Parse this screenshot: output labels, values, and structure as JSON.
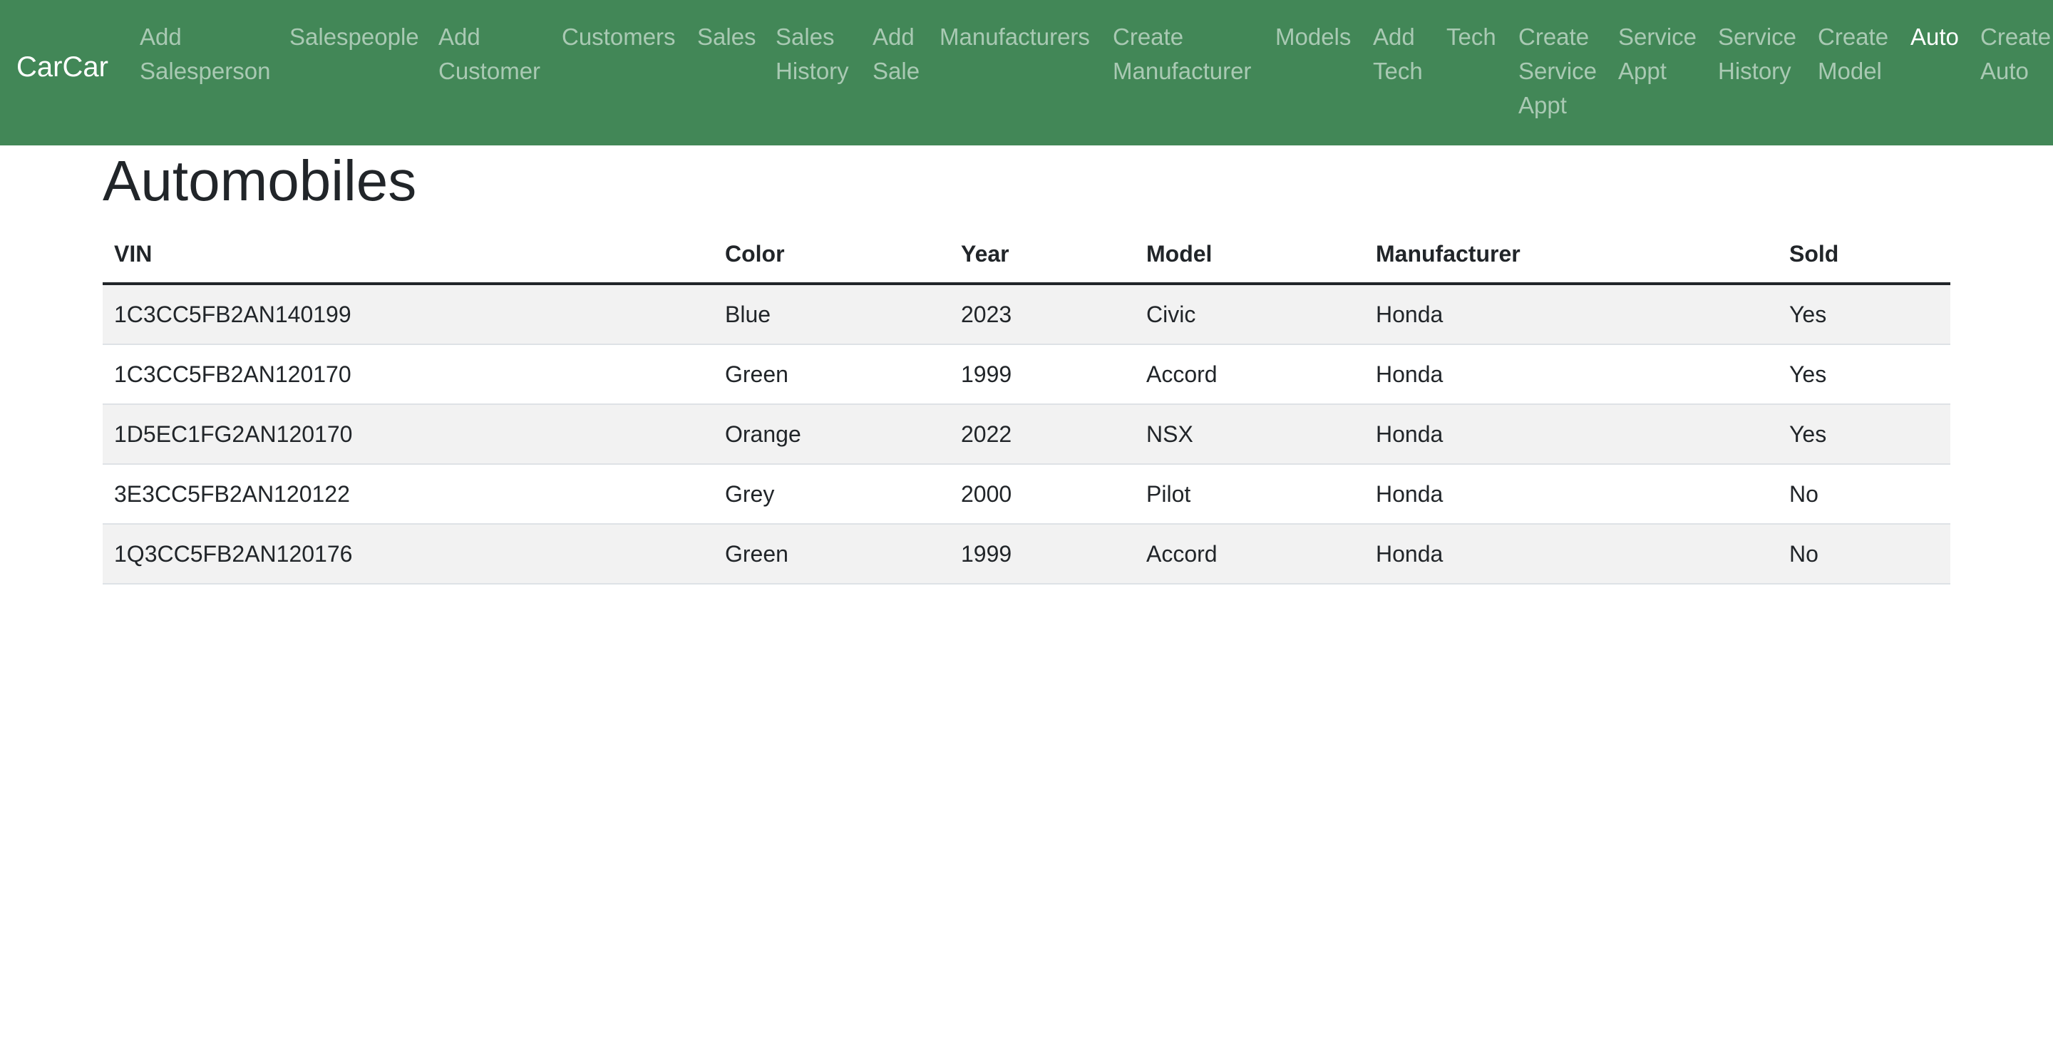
{
  "navbar": {
    "brand": "CarCar",
    "items": [
      {
        "label": "Add\nSalesperson",
        "active": false
      },
      {
        "label": "Salespeople",
        "active": false
      },
      {
        "label": "Add\nCustomer",
        "active": false
      },
      {
        "label": "Customers",
        "active": false
      },
      {
        "label": "Sales",
        "active": false
      },
      {
        "label": "Sales\nHistory",
        "active": false
      },
      {
        "label": "Add\nSale",
        "active": false
      },
      {
        "label": "Manufacturers",
        "active": false
      },
      {
        "label": "Create\nManufacturer",
        "active": false
      },
      {
        "label": "Models",
        "active": false
      },
      {
        "label": "Add\nTech",
        "active": false
      },
      {
        "label": "Tech",
        "active": false
      },
      {
        "label": "Create\nService\nAppt",
        "active": false
      },
      {
        "label": "Service\nAppt",
        "active": false
      },
      {
        "label": "Service\nHistory",
        "active": false
      },
      {
        "label": "Create\nModel",
        "active": false
      },
      {
        "label": "Auto",
        "active": true
      },
      {
        "label": "Create\nAuto",
        "active": false
      }
    ]
  },
  "page": {
    "title": "Automobiles"
  },
  "table": {
    "headers": {
      "vin": "VIN",
      "color": "Color",
      "year": "Year",
      "model": "Model",
      "manufacturer": "Manufacturer",
      "sold": "Sold"
    },
    "rows": [
      {
        "vin": "1C3CC5FB2AN140199",
        "color": "Blue",
        "year": "2023",
        "model": "Civic",
        "manufacturer": "Honda",
        "sold": "Yes"
      },
      {
        "vin": "1C3CC5FB2AN120170",
        "color": "Green",
        "year": "1999",
        "model": "Accord",
        "manufacturer": "Honda",
        "sold": "Yes"
      },
      {
        "vin": "1D5EC1FG2AN120170",
        "color": "Orange",
        "year": "2022",
        "model": "NSX",
        "manufacturer": "Honda",
        "sold": "Yes"
      },
      {
        "vin": "3E3CC5FB2AN120122",
        "color": "Grey",
        "year": "2000",
        "model": "Pilot",
        "manufacturer": "Honda",
        "sold": "No"
      },
      {
        "vin": "1Q3CC5FB2AN120176",
        "color": "Green",
        "year": "1999",
        "model": "Accord",
        "manufacturer": "Honda",
        "sold": "No"
      }
    ]
  },
  "colors": {
    "navbar_bg": "#428757",
    "stripe": "#f2f2f2"
  }
}
